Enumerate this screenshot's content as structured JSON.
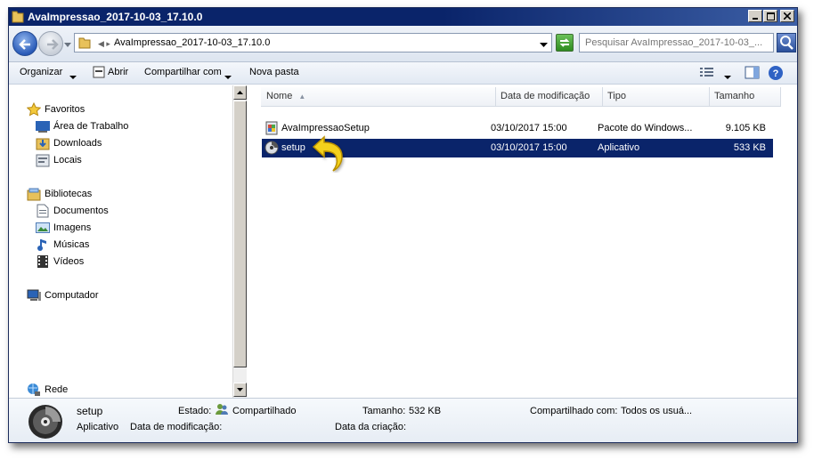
{
  "window": {
    "title": "AvaImpressao_2017-10-03_17.10.0"
  },
  "address_bar": {
    "path": "AvaImpressao_2017-10-03_17.10.0",
    "search_placeholder": "Pesquisar AvaImpressao_2017-10-03_..."
  },
  "toolbar": {
    "organize": "Organizar",
    "open": "Abrir",
    "share": "Compartilhar com",
    "new_folder": "Nova pasta"
  },
  "nav_pane": {
    "favorites": {
      "label": "Favoritos",
      "items": [
        "Área de Trabalho",
        "Downloads",
        "Locais"
      ]
    },
    "libraries": {
      "label": "Bibliotecas",
      "items": [
        "Documentos",
        "Imagens",
        "Músicas",
        "Vídeos"
      ]
    },
    "computer": "Computador",
    "network": "Rede"
  },
  "columns": {
    "name": "Nome",
    "modified": "Data de modificação",
    "type": "Tipo",
    "size": "Tamanho"
  },
  "files": [
    {
      "name": "AvaImpressaoSetup",
      "modified": "03/10/2017 15:00",
      "type": "Pacote do Windows...",
      "size": "9.105 KB",
      "icon": "windows-installer-package-icon",
      "selected": false
    },
    {
      "name": "setup",
      "modified": "03/10/2017 15:00",
      "type": "Aplicativo",
      "size": "533 KB",
      "icon": "setup-cd-icon",
      "selected": true
    }
  ],
  "details_pane": {
    "file_name": "setup",
    "file_type": "Aplicativo",
    "state_label": "Estado:",
    "state_value": "Compartilhado",
    "size_label": "Tamanho:",
    "size_value": "532 KB",
    "shared_with_label": "Compartilhado com:",
    "shared_with_value": "Todos os usuá...",
    "modified_label": "Data de modificação:",
    "modified_value": "",
    "created_label": "Data da criação:",
    "created_value": ""
  },
  "colors": {
    "title_bar": "#0a246a",
    "selection": "#0a246a",
    "cursor_arrow": "#f2c811"
  }
}
